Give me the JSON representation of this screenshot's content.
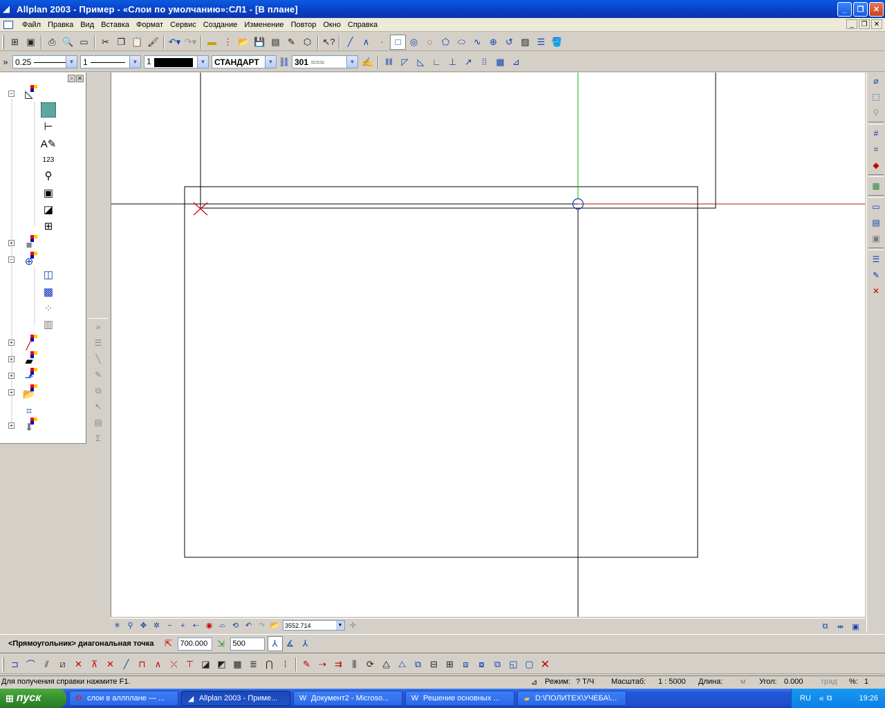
{
  "window": {
    "title": "Allplan 2003 - Пример - «Слои по умолчанию»:СЛ1 - [В плане]",
    "controls": {
      "minimize": "_",
      "maximize": "❐",
      "close": "✕"
    }
  },
  "menu": {
    "items": [
      "Файл",
      "Правка",
      "Вид",
      "Вставка",
      "Формат",
      "Сервис",
      "Создание",
      "Изменение",
      "Повтор",
      "Окно",
      "Справка"
    ]
  },
  "format_bar": {
    "pen_thickness": "0.25",
    "line_type": "1",
    "color": "1",
    "layer": "СТАНДАРТ",
    "hatch": "301"
  },
  "view_bar": {
    "zoom_value": "3552.714"
  },
  "dialog_bar": {
    "prompt": "<Прямоугольник> диагональная точка",
    "dx_value": "700.000",
    "dy_value": "500"
  },
  "status_bar": {
    "help": "Для получения справки нажмите F1.",
    "mode_label": "Режим:",
    "mode_value": "? Т/Ч",
    "scale_label": "Масштаб:",
    "scale_value": "1 : 5000",
    "length_label": "Длина:",
    "length_unit": "м",
    "angle_label": "Угол:",
    "angle_value": "0.000",
    "angle_unit": "град",
    "percent_label": "%:",
    "percent_value": "1"
  },
  "taskbar": {
    "start_label": "пуск",
    "tasks": [
      {
        "label": "слои в аллплане — ...",
        "icon": "opera-icon",
        "active": false
      },
      {
        "label": "Allplan 2003 - Приме...",
        "icon": "allplan-icon",
        "active": true
      },
      {
        "label": "Документ2 - Microso...",
        "icon": "word-icon",
        "active": false
      },
      {
        "label": "Решение основных ...",
        "icon": "word-icon",
        "active": false
      },
      {
        "label": "D:\\ПОЛИТЕХ\\УЧЕБА\\...",
        "icon": "folder-icon",
        "active": false
      }
    ],
    "language": "RU",
    "clock": "19:26"
  },
  "colors": {
    "titlebar": "#0a3ec4",
    "crosshair_horizontal": "#cc0000",
    "crosshair_vertical": "#00bb00",
    "taskbar": "#2050d0",
    "start": "#348c2c"
  }
}
